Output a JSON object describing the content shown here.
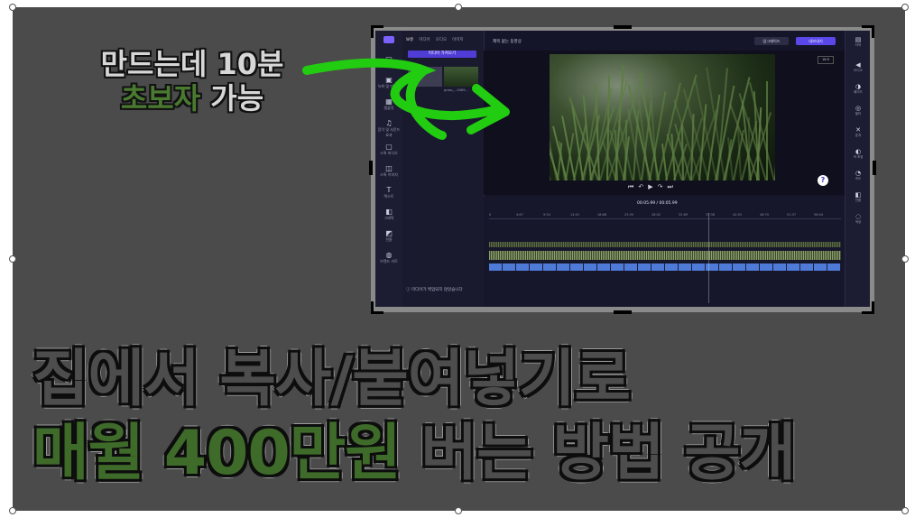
{
  "caption_top": {
    "line1": "만드는데 10분",
    "line2_green": "초보자",
    "line2_rest": " 가능"
  },
  "headline": {
    "line1": "집에서 복사/붙여넣기로",
    "line2_green": "매월 400만원",
    "line2_rest": " 버는 방법 공개"
  },
  "colors": {
    "slide_bg": "#4b4b4b",
    "accent_green": "#3e6b2a",
    "arrow_green": "#22cc11",
    "app_bg": "#15152a",
    "export_blue": "#5a48ea"
  },
  "editor": {
    "tabs": [
      "보유",
      "미디어",
      "오디오",
      "이미지"
    ],
    "import_button": "미디어 가져오기",
    "left_rail": [
      "미디어",
      "녹화 및 만들기",
      "템플릿",
      "음악 및 사운드 효과",
      "스톡 비디오",
      "스톡 이미지",
      "텍스트",
      "그래픽",
      "전환",
      "브랜드 키트"
    ],
    "thumb1_label": "3.5K",
    "thumb2_label": "grass_...0089...",
    "project_name": "제목 없는 동영상",
    "upgrade_label": "업그레이드",
    "export_label": "내보내기",
    "ratio_label": "16:9",
    "help_label": "?",
    "controls": [
      "⏮",
      "↶",
      "▶",
      "↷",
      "⏭"
    ],
    "timecode": "00:05.99 / 00:05.99",
    "ruler_ticks": [
      "0",
      "4:67",
      "9:34",
      "14:01",
      "18:68",
      "23:35",
      "28:02",
      "32:69",
      "37:36",
      "42:03",
      "46:70",
      "51:37",
      "56:04"
    ],
    "footer_notice": "미디어가 백업되지 않았습니다",
    "right_rail": [
      "자막",
      "오디오",
      "페이드",
      "필터",
      "효과",
      "색 조정",
      "속도",
      "전환",
      "색상"
    ]
  }
}
